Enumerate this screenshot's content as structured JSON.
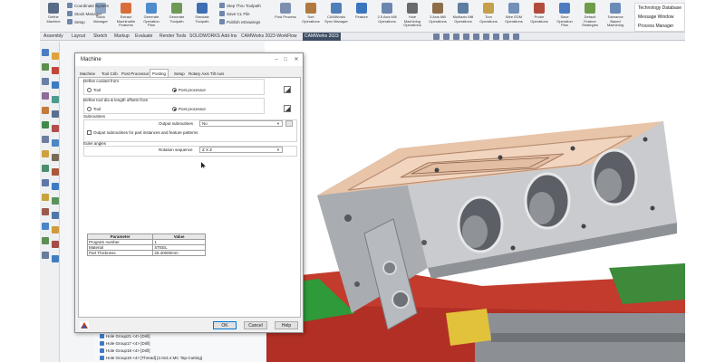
{
  "ribbon": {
    "left_buttons": [
      {
        "label": "Define Machine",
        "icon": "machine-icon",
        "color": "#5a6b86"
      },
      {
        "label": "Stock Manager",
        "icon": "stock-icon",
        "color": "#8fa5c4"
      },
      {
        "label": "Extract Machinable Features",
        "icon": "extract-icon",
        "color": "#d86e3a"
      },
      {
        "label": "Generate Operation Plan",
        "icon": "plan-icon",
        "color": "#4f8ccc"
      },
      {
        "label": "Generate Toolpath",
        "icon": "toolpath-icon",
        "color": "#6e9a55"
      },
      {
        "label": "Simulate Toolpath",
        "icon": "simulate-icon",
        "color": "#3f6fb3"
      }
    ],
    "small_rows": [
      {
        "label": "Coordinate System",
        "icon": "coordinate-icon"
      },
      {
        "label": "Stock Manager",
        "icon": "stock-small-icon"
      },
      {
        "label": "Setup",
        "icon": "setup-icon"
      },
      {
        "label": "Step Thru Toolpath",
        "icon": "step-icon"
      },
      {
        "label": "Save CL File",
        "icon": "save-cl-icon"
      },
      {
        "label": "Publish eDrawings",
        "icon": "publish-icon"
      }
    ],
    "right_buttons": [
      {
        "label": "Post Process",
        "icon": "post-process-icon",
        "color": "#7c8fb0"
      },
      {
        "label": "Sort Operations",
        "icon": "sort-icon",
        "color": "#b07a3e"
      },
      {
        "label": "CAMWorks Sync Manager",
        "icon": "sync-icon",
        "color": "#4f7fb8"
      },
      {
        "label": "Feature",
        "icon": "feature-icon",
        "color": "#3a75c0"
      },
      {
        "label": "2.5 Axis Mill Operations",
        "icon": "mill-25-icon",
        "color": "#6d86b0"
      },
      {
        "label": "Hole Machining Operations",
        "icon": "hole-icon",
        "color": "#6a6a6a"
      },
      {
        "label": "3 Axis Mill Operations",
        "icon": "mill-3-icon",
        "color": "#8e6e4a"
      },
      {
        "label": "Multiaxis Mill Operations",
        "icon": "multiaxis-icon",
        "color": "#5e7ea0"
      },
      {
        "label": "Turn Operations",
        "icon": "turn-icon",
        "color": "#c4a04a"
      },
      {
        "label": "Wire EDM Operations",
        "icon": "wire-edm-icon",
        "color": "#7391b8"
      },
      {
        "label": "Probe Operations",
        "icon": "probe-icon",
        "color": "#b34b3c"
      },
      {
        "label": "Save Operation Plan",
        "icon": "save-plan-icon",
        "color": "#4c7cbf"
      },
      {
        "label": "Default Feature Strategies",
        "icon": "strategy-icon",
        "color": "#6f9c49"
      },
      {
        "label": "Tolerance Based Machining",
        "icon": "tolerance-icon",
        "color": "#6b8bb7"
      }
    ],
    "panel_items": [
      "Technology Database",
      "Message Window",
      "Process Manager"
    ]
  },
  "tabs": [
    "Assembly",
    "Layout",
    "Sketch",
    "Markup",
    "Evaluate",
    "Render Tools",
    "SOLIDWORKS Add-Ins",
    "CAMWorks 2023-WorkFlow",
    "CAMWorks 2023"
  ],
  "active_tab": "CAMWorks 2023",
  "dialog": {
    "title": "Machine",
    "tabs": [
      "Machine",
      "Tool Crib",
      "Post Processor",
      "Posting",
      "Setup",
      "Rotary Axis",
      "Tilt Axis"
    ],
    "active_tab": "Posting",
    "coolant_label": "Define coolant from",
    "coolant_options": [
      "Tool",
      "Post processor"
    ],
    "offsets_label": "Define tool dia & length offsets from",
    "offsets_options": [
      "Tool",
      "Post processor"
    ],
    "subroutines_label": "Subroutines",
    "output_subroutines_label": "Output subroutines",
    "output_subroutines_value": "No",
    "output_subroutines_checkbox": "Output subroutines for part instances and feature patterns",
    "euler_label": "Euler angles",
    "rotation_sequence_label": "Rotation sequence",
    "rotation_sequence_value": "Z X Z",
    "table_headers": [
      "Parameter",
      "Value"
    ],
    "table_rows": [
      [
        "Program number",
        "1"
      ],
      [
        "Material",
        "STEEL"
      ],
      [
        "Part Thickness",
        "25.40000mm"
      ]
    ],
    "buttons": {
      "ok": "OK",
      "cancel": "Cancel",
      "help": "Help"
    }
  },
  "tree": {
    "rows": [
      "Hole Group21 <4> [Drill]",
      "Hole Group17 <4> [Drill]",
      "Hole Group18 <4> [Drill]",
      "Hole Group19 <4> [Thread] [2.0x3.4 MC Tap-Cutting]"
    ]
  }
}
